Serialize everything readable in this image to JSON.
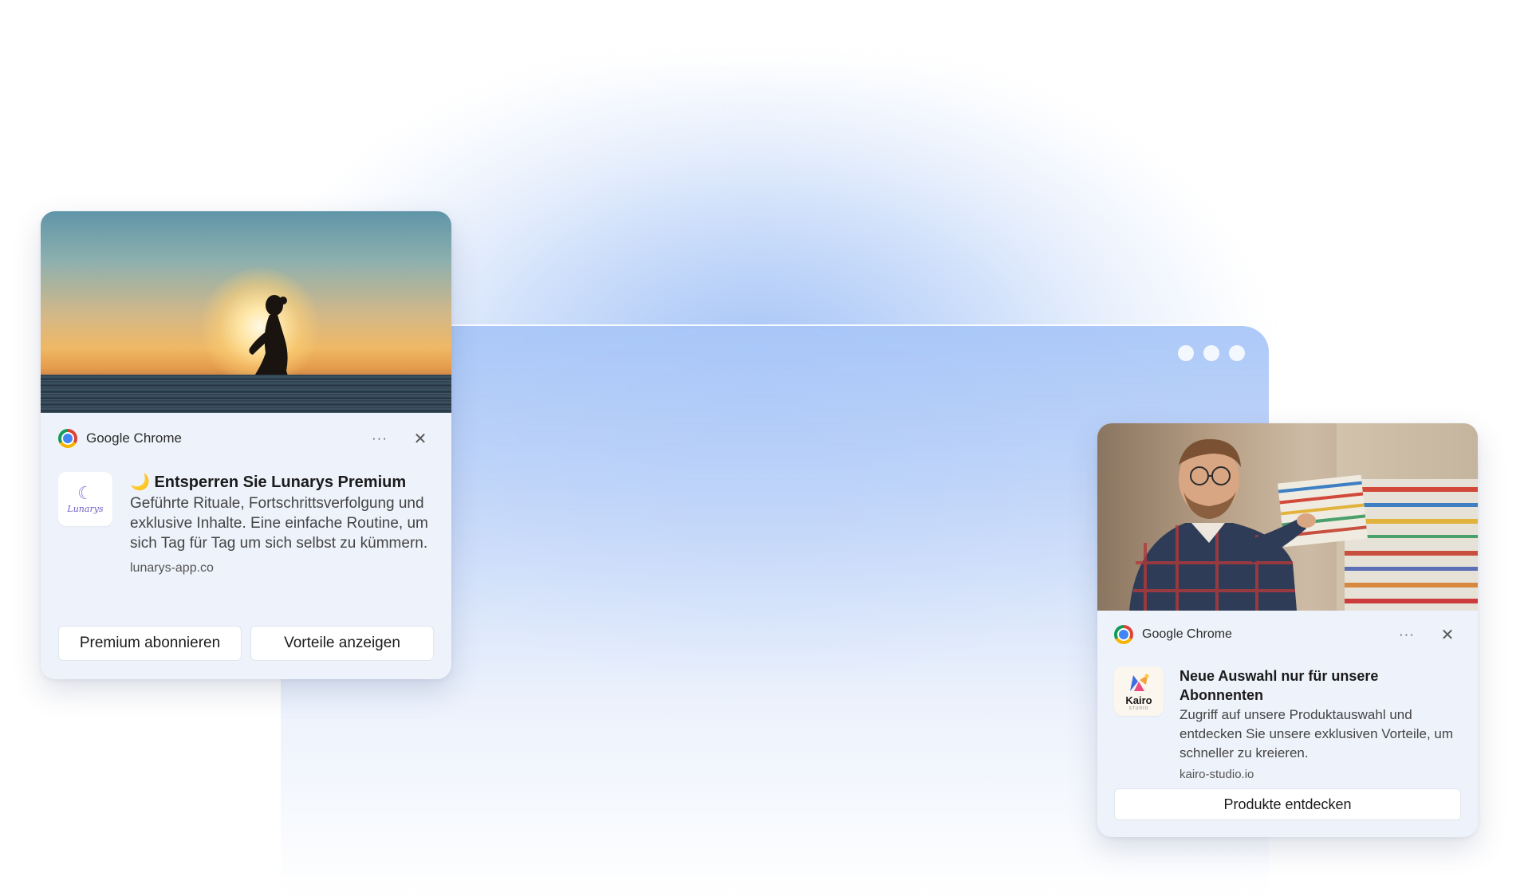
{
  "notifications": [
    {
      "source": "Google Chrome",
      "more_label": "···",
      "close_label": "✕",
      "app_logo_text": "Lunarys",
      "title": "🌙 Entsperren Sie Lunarys Premium",
      "message": "Geführte Rituale, Fortschrittsverfolgung und exklusive Inhalte. Eine einfache Routine, um sich Tag für Tag um sich selbst zu kümmern.",
      "domain": "lunarys-app.co",
      "buttons": [
        "Premium abonnieren",
        "Vorteile anzeigen"
      ]
    },
    {
      "source": "Google Chrome",
      "more_label": "···",
      "close_label": "✕",
      "app_logo_text": "Kairo",
      "app_logo_subtext": "STUDIO",
      "title": "Neue Auswahl nur für unsere Abonnenten",
      "message": "Zugriff auf unsere Produktauswahl und entdecken Sie unsere exklusiven Vorteile, um schneller zu kreieren.",
      "domain": "kairo-studio.io",
      "buttons": [
        "Produkte entdecken"
      ]
    }
  ],
  "colors": {
    "card_background": "#eef2fa",
    "accent_blue": "#a8c6f8"
  }
}
